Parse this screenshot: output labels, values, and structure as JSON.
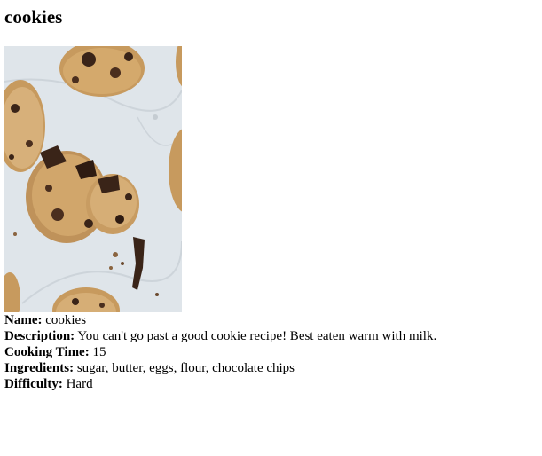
{
  "recipe": {
    "title": "cookies",
    "image_subject": "chocolate-chip-cookies-photo",
    "fields": {
      "name_label": "Name:",
      "name_value": "cookies",
      "description_label": "Description:",
      "description_value": "You can't go past a good cookie recipe! Best eaten warm with milk.",
      "cooking_time_label": "Cooking Time:",
      "cooking_time_value": "15",
      "ingredients_label": "Ingredients:",
      "ingredients_value": "sugar, butter, eggs, flour, chocolate chips",
      "difficulty_label": "Difficulty:",
      "difficulty_value": "Hard"
    }
  },
  "colors": {
    "text": "#000000",
    "background": "#ffffff",
    "photo_background": "#dfe5ea",
    "cookie_dough": "#c79a5e",
    "chocolate": "#3a2418"
  }
}
